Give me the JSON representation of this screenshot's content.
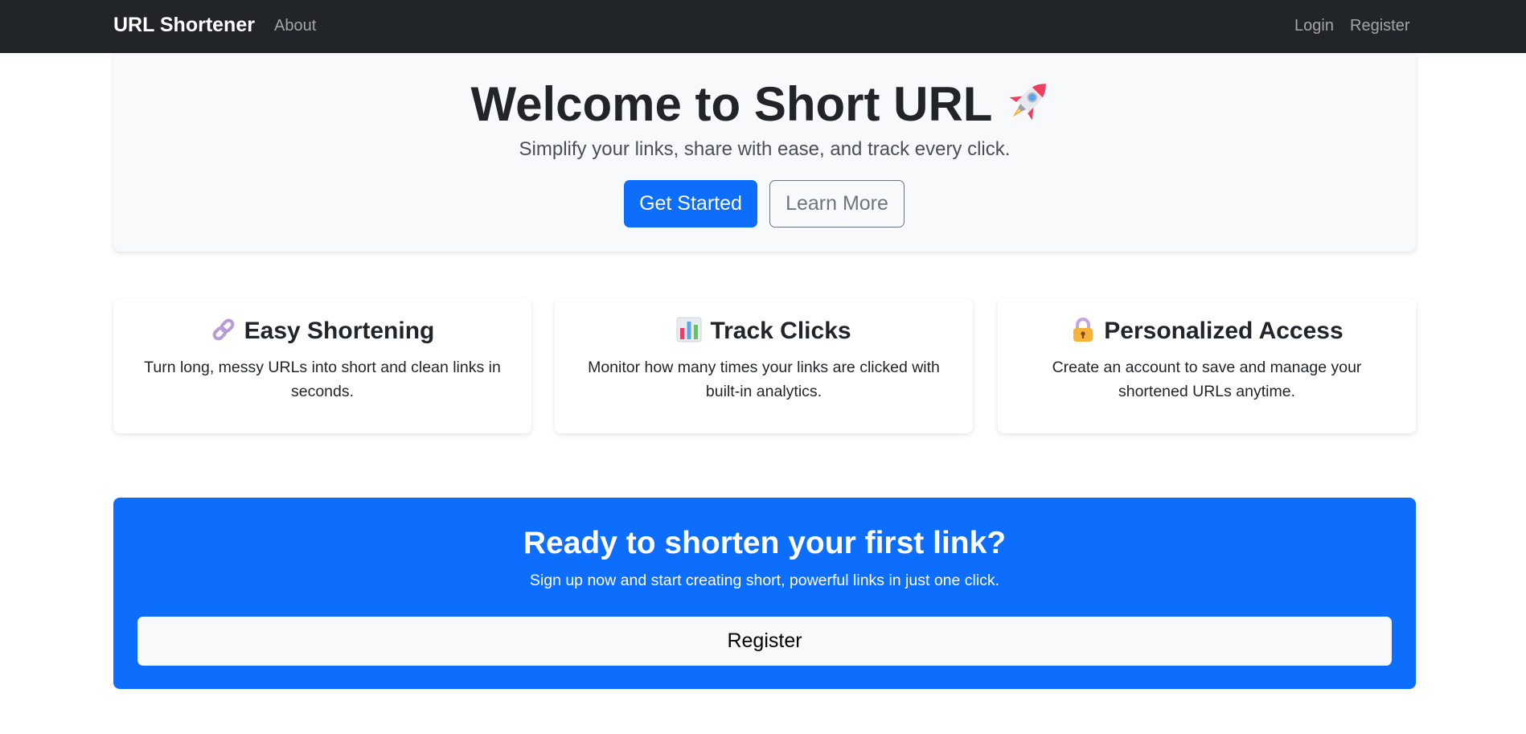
{
  "navbar": {
    "brand": "URL Shortener",
    "about": "About",
    "login": "Login",
    "register": "Register"
  },
  "hero": {
    "title": "Welcome to Short URL",
    "title_icon": "rocket-icon",
    "subtitle": "Simplify your links, share with ease, and track every click.",
    "primary_button": "Get Started",
    "secondary_button": "Learn More"
  },
  "features": [
    {
      "icon": "link-icon",
      "title": "Easy Shortening",
      "text": "Turn long, messy URLs into short and clean links in seconds."
    },
    {
      "icon": "bar-chart-icon",
      "title": "Track Clicks",
      "text": "Monitor how many times your links are clicked with built-in analytics."
    },
    {
      "icon": "lock-icon",
      "title": "Personalized Access",
      "text": "Create an account to save and manage your shortened URLs anytime."
    }
  ],
  "cta": {
    "title": "Ready to shorten your first link?",
    "subtitle": "Sign up now and start creating short, powerful links in just one click.",
    "button": "Register"
  },
  "colors": {
    "navbar_bg": "#212529",
    "primary": "#0d6efd",
    "hero_bg": "#f8f9fa",
    "secondary": "#6c757d"
  }
}
